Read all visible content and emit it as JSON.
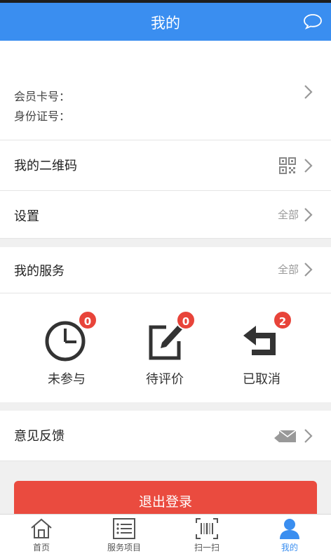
{
  "header": {
    "title": "我的"
  },
  "profile": {
    "member_card_label": "会员卡号：",
    "id_card_label": "身份证号："
  },
  "qr_row": {
    "label": "我的二维码"
  },
  "settings_row": {
    "label": "设置",
    "right_text": "全部"
  },
  "services": {
    "header_label": "我的服务",
    "header_right": "全部",
    "items": [
      {
        "label": "未参与",
        "badge": "0",
        "icon": "clock-icon"
      },
      {
        "label": "待评价",
        "badge": "0",
        "icon": "edit-icon"
      },
      {
        "label": "已取消",
        "badge": "2",
        "icon": "return-icon"
      }
    ]
  },
  "feedback_row": {
    "label": "意见反馈"
  },
  "logout_button": "退出登录",
  "tabs": [
    {
      "label": "首页",
      "icon": "home-icon"
    },
    {
      "label": "服务项目",
      "icon": "list-icon"
    },
    {
      "label": "扫一扫",
      "icon": "barcode-icon"
    },
    {
      "label": "我的",
      "icon": "user-icon",
      "active": true
    }
  ],
  "colors": {
    "header": "#3a8ef0",
    "badge": "#e8443a",
    "logout": "#ea4b3f",
    "active_tab": "#3a8ef0"
  }
}
